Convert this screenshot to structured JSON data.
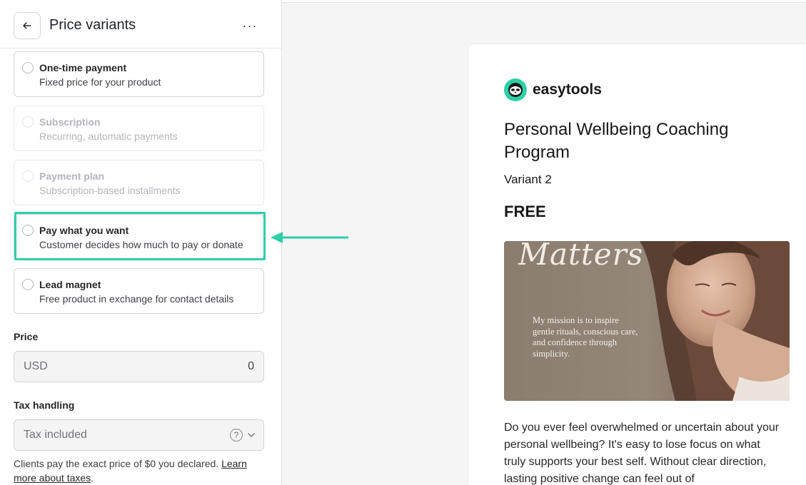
{
  "header": {
    "title": "Price variants",
    "more_label": "···"
  },
  "options": [
    {
      "title": "One-time payment",
      "desc": "Fixed price for your product",
      "disabled": false
    },
    {
      "title": "Subscription",
      "desc": "Recurring, automatic payments",
      "disabled": true
    },
    {
      "title": "Payment plan",
      "desc": "Subscription-based installments",
      "disabled": true
    },
    {
      "title": "Pay what you want",
      "desc": "Customer decides how much to pay or donate",
      "disabled": false,
      "highlighted": true
    },
    {
      "title": "Lead magnet",
      "desc": "Free product in exchange for contact details",
      "disabled": false
    }
  ],
  "price": {
    "label": "Price",
    "currency": "USD",
    "value": "0"
  },
  "tax": {
    "label": "Tax handling",
    "value": "Tax included",
    "help_glyph": "?",
    "note": "Clients pay the exact price of $0 you declared. ",
    "link": "Learn more about taxes",
    "note_end": "."
  },
  "preview": {
    "brand": "easytools",
    "title": "Personal Wellbeing Coaching Program",
    "variant": "Variant 2",
    "price": "FREE",
    "image_script": "Matters",
    "image_text": "My mission is to inspire gentle rituals, conscious care, and confidence through simplicity.",
    "description": "Do you ever feel overwhelmed or uncertain about your personal wellbeing? It's easy to lose focus on what truly supports your best self. Without clear direction, lasting positive change can feel out of"
  },
  "colors": {
    "accent": "#2ecfa6",
    "panel_bg": "#ffffff",
    "canvas_bg": "#f5f5f5"
  },
  "icons": {
    "back": "arrow-left-icon",
    "more": "more-horizontal-icon",
    "help": "question-circle-icon",
    "chevron": "chevron-down-icon",
    "logo": "sloth-logo-icon"
  }
}
